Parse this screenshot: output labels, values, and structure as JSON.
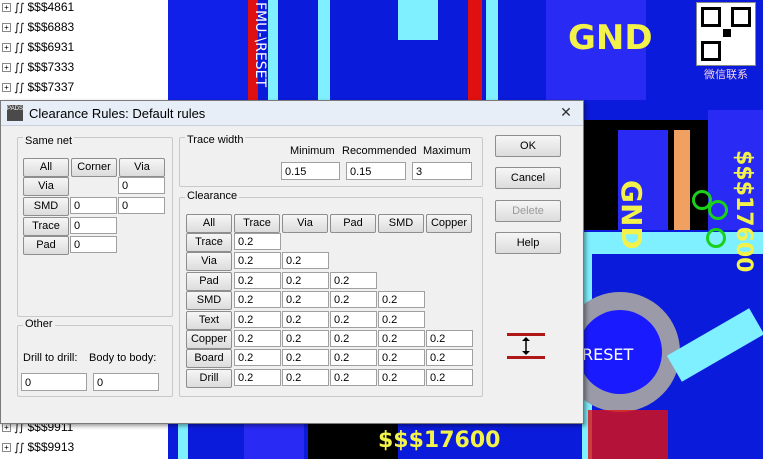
{
  "tree": {
    "items_top": [
      "$$$4861",
      "$$$6883",
      "$$$6931",
      "$$$7333",
      "$$$7337"
    ],
    "items_bottom": [
      "$$$9911",
      "$$$9913"
    ]
  },
  "pcb": {
    "gnd_top": "GND",
    "gnd_right": "GND",
    "net_right": "$$$17600",
    "net_bottom": "$$$17600",
    "fmu_reset": "FMU-\\RESET",
    "reset_mid": "RESET",
    "qr_caption": "微信联系"
  },
  "dialog": {
    "title": "Clearance Rules: Default rules",
    "close": "✕",
    "same_net": {
      "label": "Same net",
      "btn_all": "All",
      "btn_corner": "Corner",
      "btn_via": "Via",
      "rows": [
        {
          "label": "Via",
          "values": [
            "",
            "0"
          ]
        },
        {
          "label": "SMD",
          "values": [
            "0",
            "0"
          ]
        },
        {
          "label": "Trace",
          "values": [
            "0"
          ]
        },
        {
          "label": "Pad",
          "values": [
            "0"
          ]
        }
      ]
    },
    "other": {
      "label": "Other",
      "drill_label": "Drill to drill:",
      "body_label": "Body to body:",
      "drill_value": "0",
      "body_value": "0"
    },
    "trace_width": {
      "label": "Trace width",
      "minimum_label": "Minimum",
      "recommended_label": "Recommended",
      "maximum_label": "Maximum",
      "minimum": "0.15",
      "recommended": "0.15",
      "maximum": "3"
    },
    "clearance": {
      "label": "Clearance",
      "columns": [
        "All",
        "Trace",
        "Via",
        "Pad",
        "SMD",
        "Copper"
      ],
      "rows": [
        {
          "label": "Trace",
          "values": [
            "0.2"
          ]
        },
        {
          "label": "Via",
          "values": [
            "0.2",
            "0.2"
          ]
        },
        {
          "label": "Pad",
          "values": [
            "0.2",
            "0.2",
            "0.2"
          ]
        },
        {
          "label": "SMD",
          "values": [
            "0.2",
            "0.2",
            "0.2",
            "0.2"
          ]
        },
        {
          "label": "Text",
          "values": [
            "0.2",
            "0.2",
            "0.2",
            "0.2"
          ]
        },
        {
          "label": "Copper",
          "values": [
            "0.2",
            "0.2",
            "0.2",
            "0.2",
            "0.2"
          ]
        },
        {
          "label": "Board",
          "values": [
            "0.2",
            "0.2",
            "0.2",
            "0.2",
            "0.2"
          ]
        },
        {
          "label": "Drill",
          "values": [
            "0.2",
            "0.2",
            "0.2",
            "0.2",
            "0.2"
          ]
        }
      ]
    },
    "buttons": {
      "ok": "OK",
      "cancel": "Cancel",
      "delete": "Delete",
      "help": "Help"
    }
  }
}
